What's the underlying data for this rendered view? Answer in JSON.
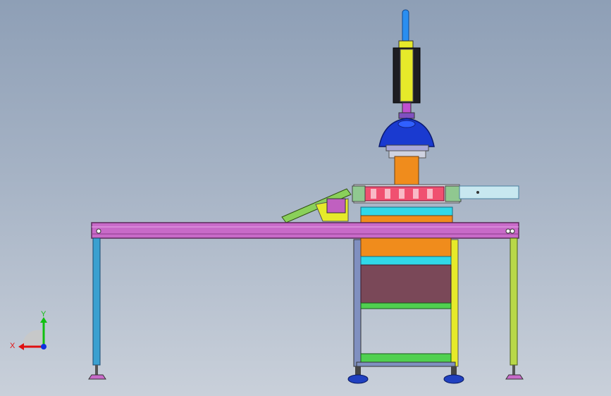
{
  "viewport": {
    "model": "machine-assembly",
    "view": "front"
  },
  "triad": {
    "x_label": "X",
    "y_label": "Y",
    "x_color": "#e01010",
    "y_color": "#10c010",
    "z_color": "#1030e0"
  },
  "colors": {
    "rail": "#c86ac8",
    "left_leg": "#3aa0d0",
    "right_leg": "#b8d848",
    "cylinder": "#e6ea2a",
    "dome": "#1a3ad0",
    "block": "#f08c1c",
    "panel": "#7a4858",
    "frame_cyan": "#30d8e8",
    "frame_green": "#50d050",
    "frame_magenta": "#e030a0",
    "feet": "#2040c0"
  }
}
